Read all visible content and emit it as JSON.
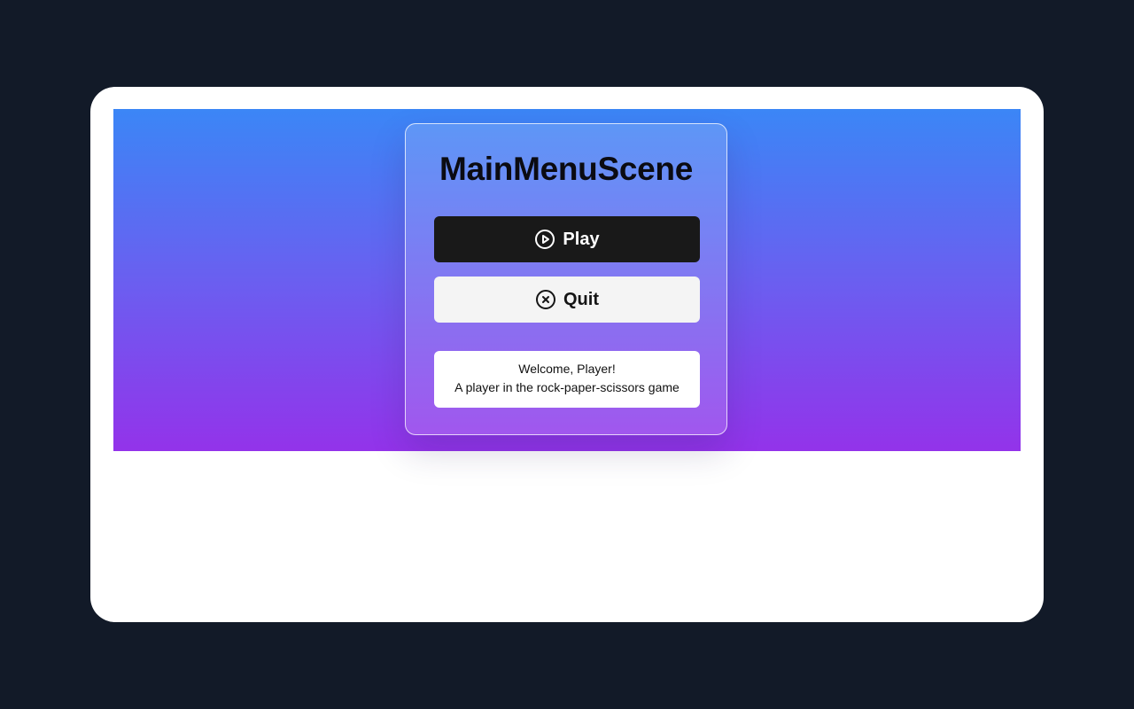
{
  "scene": {
    "title": "MainMenuScene",
    "gradient_top": "#3b86f6",
    "gradient_bottom": "#9333ea"
  },
  "buttons": {
    "play": {
      "label": "Play",
      "icon": "play-circle-icon"
    },
    "quit": {
      "label": "Quit",
      "icon": "close-circle-icon"
    }
  },
  "player": {
    "welcome": "Welcome, Player!",
    "description": "A player in the rock-paper-scissors game"
  }
}
